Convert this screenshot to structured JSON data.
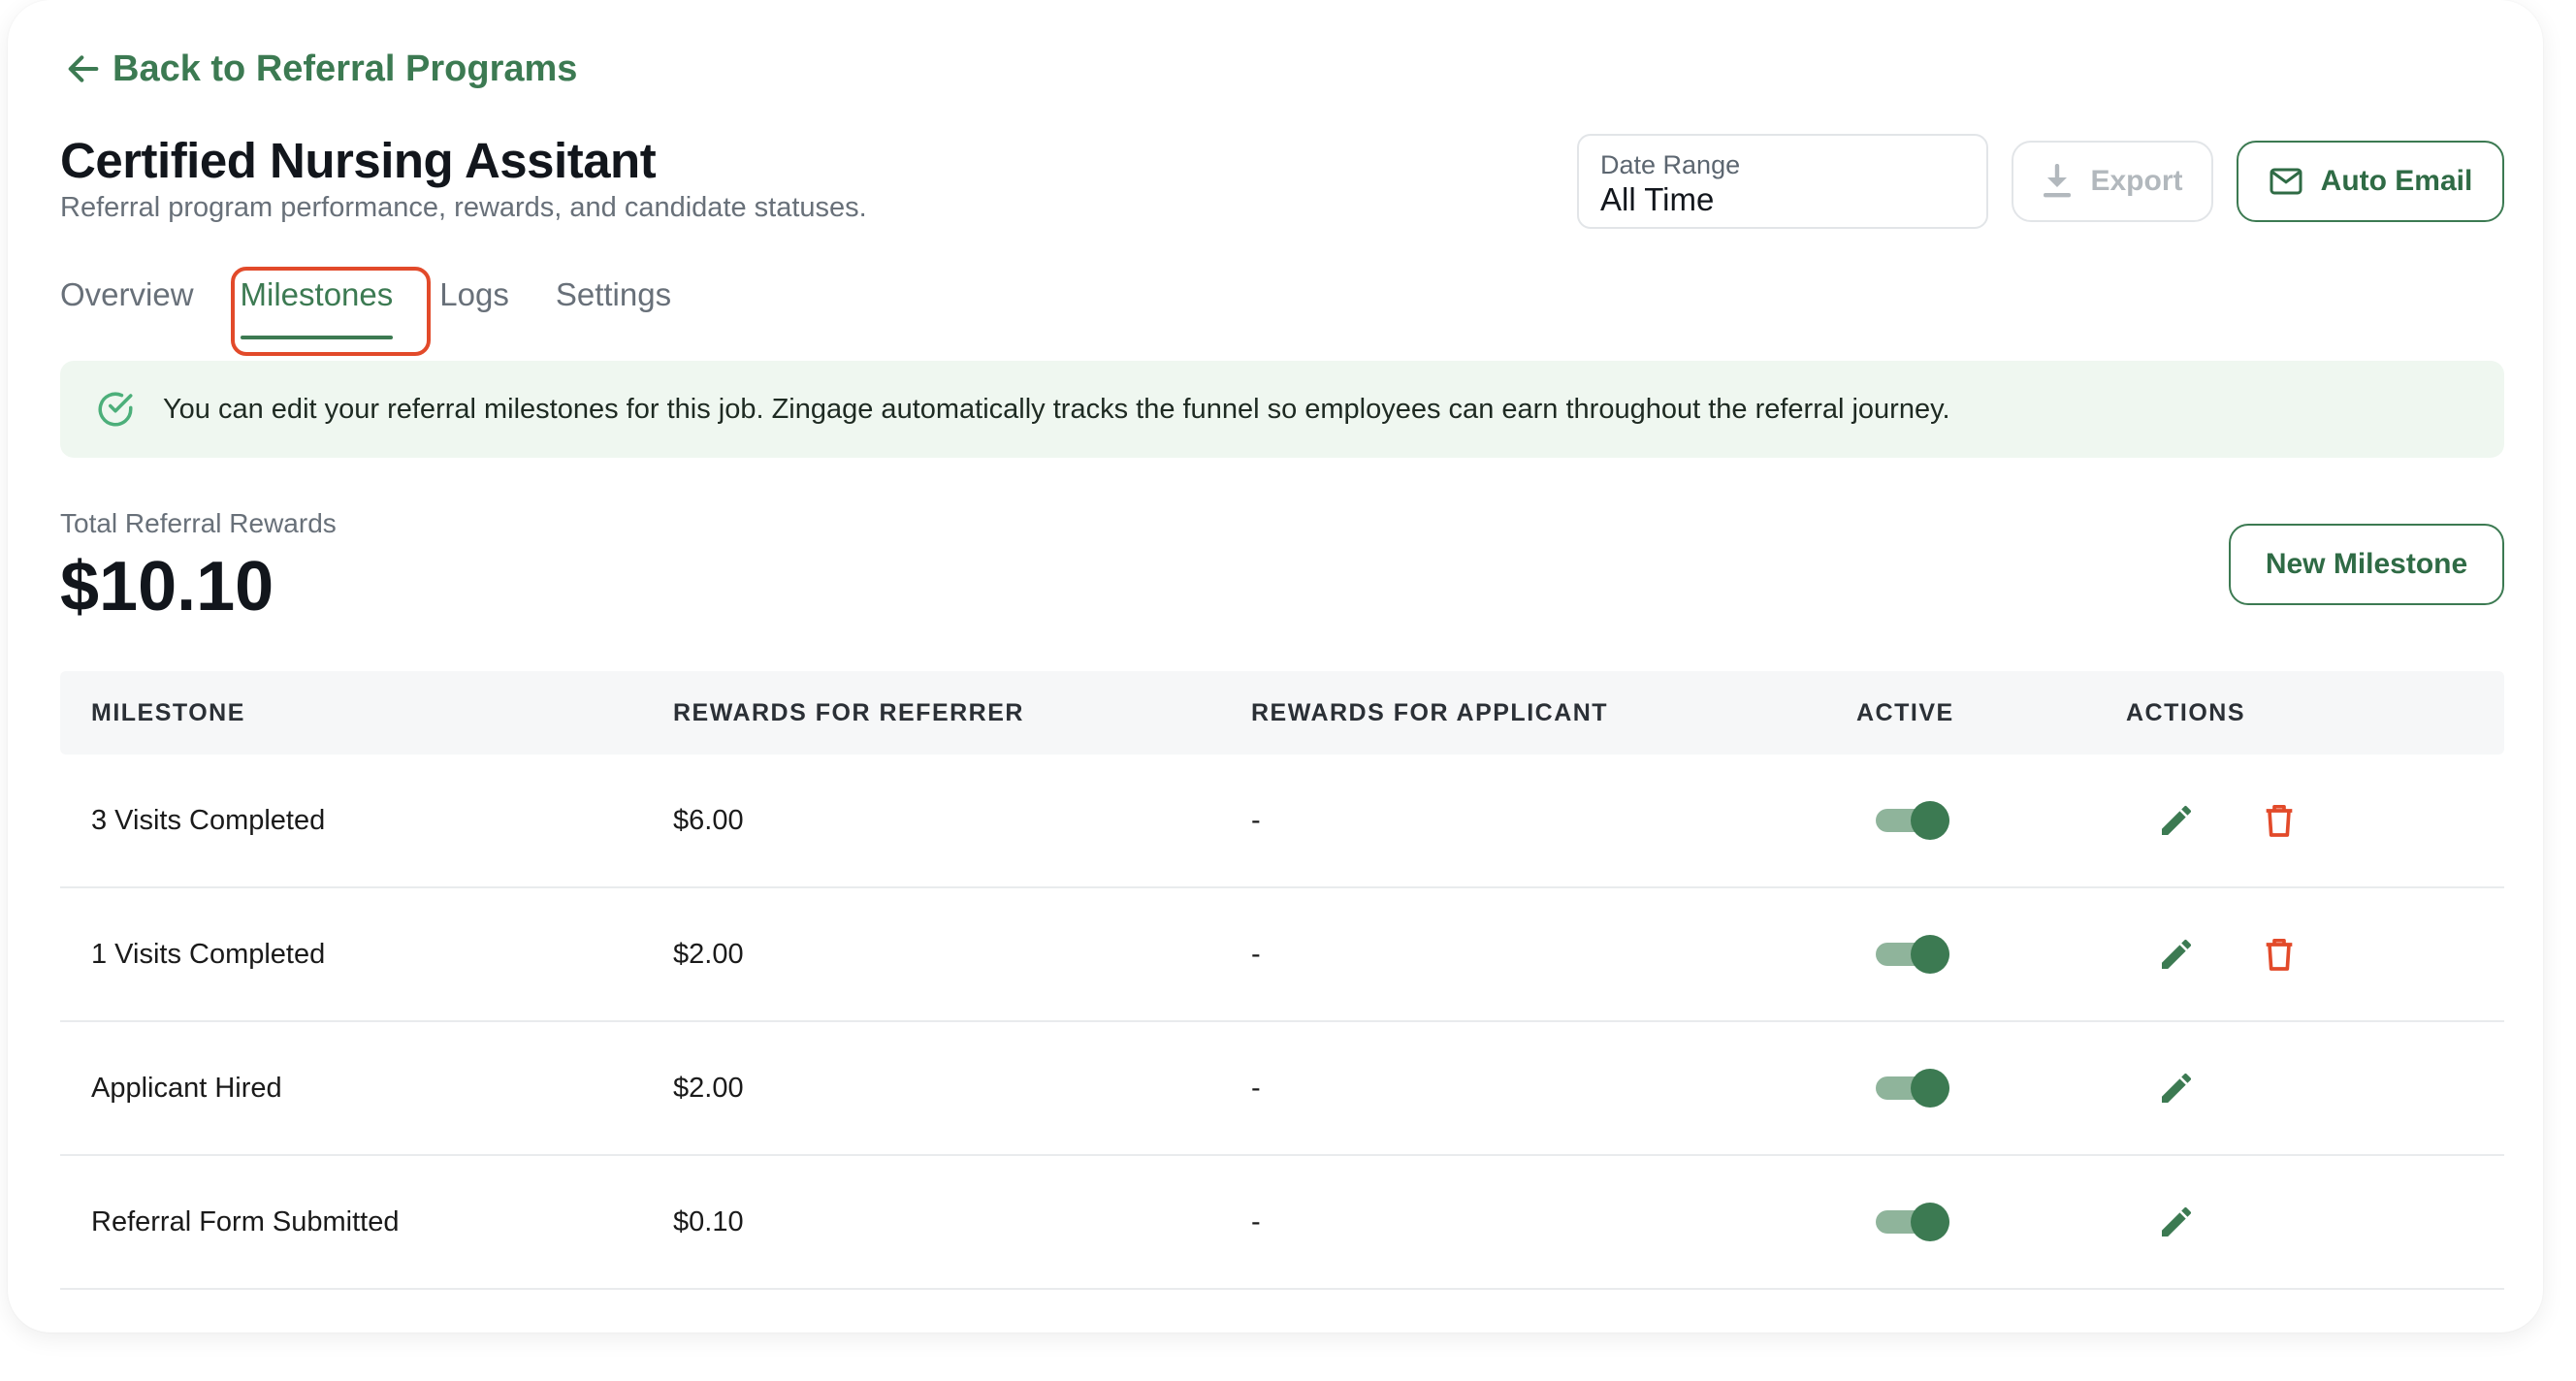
{
  "nav": {
    "back_label": "Back to Referral Programs"
  },
  "header": {
    "title": "Certified Nursing Assitant",
    "subtitle": "Referral program performance, rewards, and candidate statuses.",
    "date_range": {
      "label": "Date Range",
      "value": "All Time"
    },
    "export_label": "Export",
    "auto_email_label": "Auto Email"
  },
  "tabs": [
    {
      "label": "Overview",
      "active": false
    },
    {
      "label": "Milestones",
      "active": true
    },
    {
      "label": "Logs",
      "active": false
    },
    {
      "label": "Settings",
      "active": false
    }
  ],
  "banner": {
    "text": "You can edit your referral milestones for this job. Zingage automatically tracks the funnel so employees can earn throughout the referral journey."
  },
  "summary": {
    "label": "Total Referral Rewards",
    "value": "$10.10",
    "new_milestone_label": "New Milestone"
  },
  "table": {
    "columns": [
      "MILESTONE",
      "REWARDS FOR REFERRER",
      "REWARDS FOR APPLICANT",
      "ACTIVE",
      "ACTIONS"
    ],
    "rows": [
      {
        "milestone": "3 Visits Completed",
        "referrer_reward": "$6.00",
        "applicant_reward": "-",
        "active": true,
        "deletable": true
      },
      {
        "milestone": "1 Visits Completed",
        "referrer_reward": "$2.00",
        "applicant_reward": "-",
        "active": true,
        "deletable": true
      },
      {
        "milestone": "Applicant Hired",
        "referrer_reward": "$2.00",
        "applicant_reward": "-",
        "active": true,
        "deletable": false
      },
      {
        "milestone": "Referral Form Submitted",
        "referrer_reward": "$0.10",
        "applicant_reward": "-",
        "active": true,
        "deletable": false
      }
    ]
  },
  "colors": {
    "accent": "#3c7a52",
    "toggle_track": "#8fb49b",
    "danger": "#e24a2a",
    "banner_bg": "#eff7f0",
    "highlight": "#e24a2a"
  },
  "icons": {
    "back": "arrow-left-icon",
    "export": "download-icon",
    "auto_email": "mail-icon",
    "banner": "check-circle-icon",
    "edit": "pencil-icon",
    "delete": "trash-icon"
  }
}
